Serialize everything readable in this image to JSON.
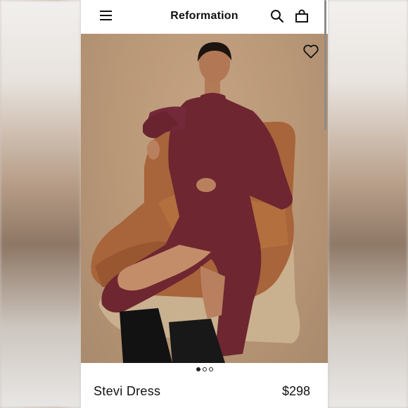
{
  "header": {
    "brand": "Reformation",
    "icons": [
      "menu-icon",
      "search-icon",
      "bag-icon"
    ]
  },
  "product": {
    "image_icon": "heart-icon",
    "carousel": {
      "total": 3,
      "active": 1
    },
    "name": "Stevi Dress",
    "price": "$298"
  },
  "colors": {
    "background": "#ffffff",
    "text": "#111111",
    "photo_backdrop": "#b99878",
    "dress": "#6e2630",
    "chair": "#a9673a"
  }
}
